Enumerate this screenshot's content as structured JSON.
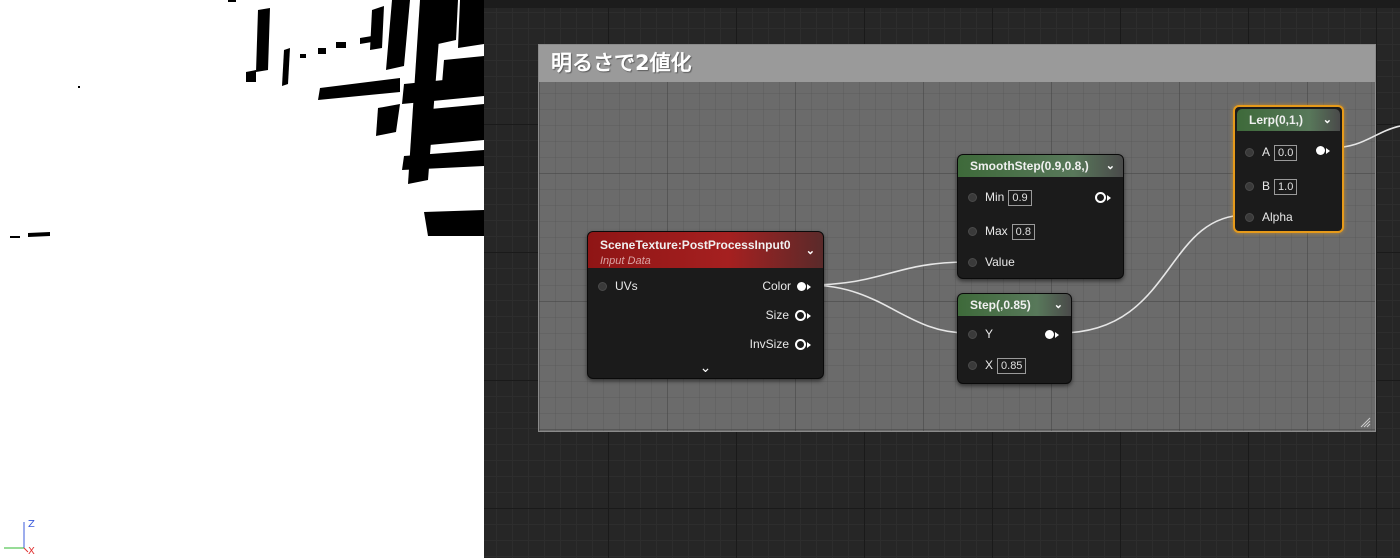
{
  "viewport": {
    "axis": {
      "z": "Z",
      "x": "X"
    },
    "colors": {
      "axis_z": "#3b5bdb",
      "axis_y": "#2fb82f",
      "axis_x": "#e03131"
    }
  },
  "comment": {
    "title": "明るさで2値化"
  },
  "nodes": {
    "scene_texture": {
      "title": "SceneTexture:PostProcessInput0",
      "subtitle": "Input Data",
      "inputs": [
        "UVs"
      ],
      "outputs": [
        "Color",
        "Size",
        "InvSize"
      ]
    },
    "smoothstep": {
      "title": "SmoothStep(0.9,0.8,)",
      "min_label": "Min",
      "min_value": "0.9",
      "max_label": "Max",
      "max_value": "0.8",
      "value_label": "Value"
    },
    "step": {
      "title": "Step(,0.85)",
      "y_label": "Y",
      "x_label": "X",
      "x_value": "0.85"
    },
    "lerp": {
      "title": "Lerp(0,1,)",
      "a_label": "A",
      "a_value": "0.0",
      "b_label": "B",
      "b_value": "1.0",
      "alpha_label": "Alpha"
    }
  },
  "colors": {
    "graph_bg": "#262626",
    "comment_bg": "#6b6b6b",
    "comment_title_bg": "#9a9a9a",
    "node_bg": "#1b1b1b",
    "header_green": "#58785a",
    "header_red": "#a52020",
    "selection": "#e69a1a",
    "wire": "#ffffff"
  }
}
